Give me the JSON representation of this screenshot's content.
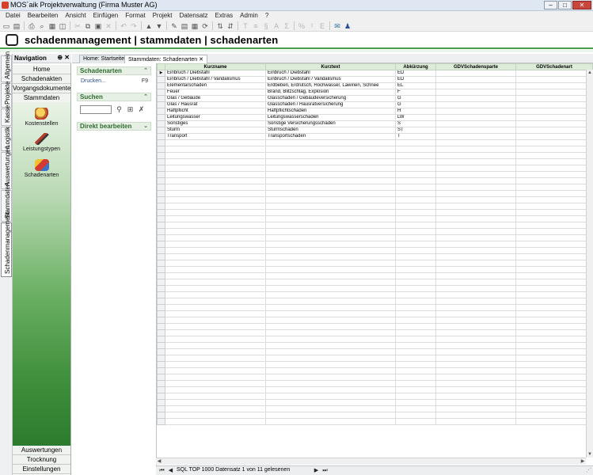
{
  "window": {
    "title": "MOS´aik Projektverwaltung (Firma Muster AG)"
  },
  "menu": [
    "Datei",
    "Bearbeiten",
    "Ansicht",
    "Einfügen",
    "Format",
    "Projekt",
    "Datensatz",
    "Extras",
    "Admin",
    "?"
  ],
  "header": {
    "title": "schadenmanagement | stammdaten | schadenarten"
  },
  "vtabs": [
    "Allgemein",
    "Projekte",
    "Kasse",
    "Logistik",
    "Auswertungen",
    "Stammdaten",
    "Schadenmanagement"
  ],
  "nav": {
    "title": "Navigation",
    "pin": "⊕ ✕",
    "top_items": [
      "Home",
      "Schadenakten",
      "Vorgangsdokumente",
      "Stammdaten"
    ],
    "tools": [
      "Kostenstellen",
      "Leistungstypen",
      "Schadenarten"
    ],
    "bottom_items": [
      "Auswertungen",
      "Trocknung",
      "Einstellungen"
    ]
  },
  "tabs": [
    "Home: Startseite",
    "Stammdaten: Schadenarten ✕"
  ],
  "tasks": {
    "schadenarten_title": "Schadenarten",
    "print_label": "Drucken...",
    "print_key": "F9",
    "search_title": "Suchen",
    "edit_title": "Direkt bearbeiten"
  },
  "grid": {
    "columns": [
      "Kurzname",
      "Kurztext",
      "Abkürzung",
      "GDVSchadensparte",
      "GDVSchadenart"
    ],
    "rows": [
      [
        "Einbruch / Diebstahl",
        "Einbruch / Diebstahl",
        "ED",
        "",
        ""
      ],
      [
        "Einbruch / Diebstahl / Vandalismus",
        "Einbruch / Diebstahl / Vandalismus",
        "ED",
        "",
        ""
      ],
      [
        "Elementarschaden",
        "Erdbeben, Erdrutsch, Hochwasser, Lawinen, Schnee",
        "EL",
        "",
        ""
      ],
      [
        "Feuer",
        "Brand, Blitzschlag, Explosion",
        "F",
        "",
        ""
      ],
      [
        "Glas / Gebäude",
        "Glasschaden / Gebäudeversicherung",
        "G",
        "",
        ""
      ],
      [
        "Glas / Hausrat",
        "Glasschaden / Hausratversicherung",
        "G",
        "",
        ""
      ],
      [
        "Haftpflicht",
        "Haftpflichtschaden",
        "H",
        "",
        ""
      ],
      [
        "Leitungswasser",
        "Leitungswasserschaden",
        "LW",
        "",
        ""
      ],
      [
        "Sonstiges",
        "Sonstige Versicherungsschäden",
        "S",
        "",
        ""
      ],
      [
        "Sturm",
        "Sturmschaden",
        "ST",
        "",
        ""
      ],
      [
        "Transport",
        "Transportschaden",
        "T",
        "",
        ""
      ]
    ],
    "current_row_marker": "▶"
  },
  "status": {
    "text": "SQL TOP 1000 Datensatz 1 von 11 gelesenen"
  }
}
